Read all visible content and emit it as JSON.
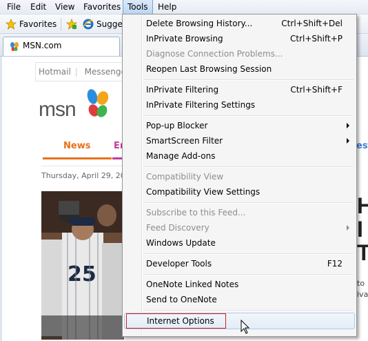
{
  "menubar": {
    "items": [
      "File",
      "Edit",
      "View",
      "Favorites",
      "Tools",
      "Help"
    ]
  },
  "favbar": {
    "favorites_label": "Favorites",
    "suggested_label": "Sugges"
  },
  "tab": {
    "title": "MSN.com"
  },
  "page": {
    "toplinks": [
      "Hotmail",
      "Messenger"
    ],
    "logo_text": "msn",
    "nav": {
      "news": "News",
      "ent": "En",
      "style": "esty"
    },
    "date": "Thursday, April 29, 20",
    "right_letters": [
      "H",
      "I",
      "T"
    ],
    "right_small": [
      "to",
      "ival"
    ]
  },
  "tools_menu": {
    "items": [
      {
        "label": "Delete Browsing History...",
        "shortcut": "Ctrl+Shift+Del",
        "disabled": false
      },
      {
        "label": "InPrivate Browsing",
        "shortcut": "Ctrl+Shift+P",
        "disabled": false
      },
      {
        "label": "Diagnose Connection Problems...",
        "shortcut": "",
        "disabled": true
      },
      {
        "label": "Reopen Last Browsing Session",
        "shortcut": "",
        "disabled": false
      },
      {
        "label": "InPrivate Filtering",
        "shortcut": "Ctrl+Shift+F",
        "disabled": false
      },
      {
        "label": "InPrivate Filtering Settings",
        "shortcut": "",
        "disabled": false
      },
      {
        "label": "Pop-up Blocker",
        "shortcut": "",
        "disabled": false,
        "submenu": true
      },
      {
        "label": "SmartScreen Filter",
        "shortcut": "",
        "disabled": false,
        "submenu": true
      },
      {
        "label": "Manage Add-ons",
        "shortcut": "",
        "disabled": false
      },
      {
        "label": "Compatibility View",
        "shortcut": "",
        "disabled": true
      },
      {
        "label": "Compatibility View Settings",
        "shortcut": "",
        "disabled": false
      },
      {
        "label": "Subscribe to this Feed...",
        "shortcut": "",
        "disabled": true
      },
      {
        "label": "Feed Discovery",
        "shortcut": "",
        "disabled": true,
        "submenu": true
      },
      {
        "label": "Windows Update",
        "shortcut": "",
        "disabled": false
      },
      {
        "label": "Developer Tools",
        "shortcut": "F12",
        "disabled": false
      },
      {
        "label": "OneNote Linked Notes",
        "shortcut": "",
        "disabled": false
      },
      {
        "label": "Send to OneNote",
        "shortcut": "",
        "disabled": false
      },
      {
        "label": "Internet Options",
        "shortcut": "",
        "disabled": false
      }
    ]
  },
  "colors": {
    "highlight_border": "#d21e1e",
    "news": "#e8701a",
    "entertainment": "#c23a9f"
  },
  "icons": [
    "favorites-star-icon",
    "add-favorite-icon",
    "ie-icon",
    "msn-butterfly-icon",
    "submenu-arrow-icon",
    "mouse-cursor-icon"
  ]
}
